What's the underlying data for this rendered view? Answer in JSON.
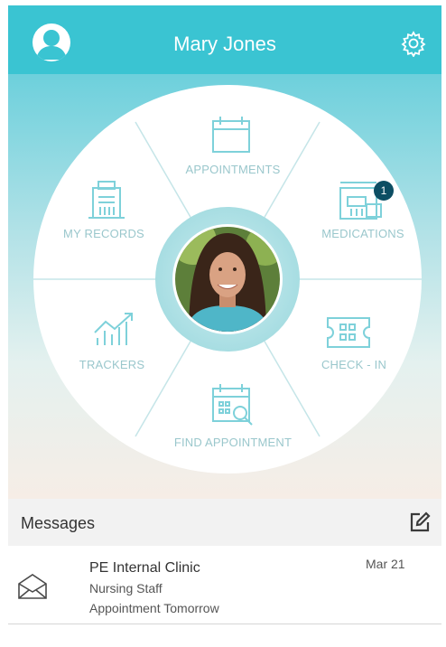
{
  "header": {
    "title": "Mary Jones",
    "accent_color": "#3ac4d2",
    "avatar_icon": "user-avatar-icon",
    "settings_icon": "gear-icon"
  },
  "dashboard": {
    "segments": [
      {
        "label": "APPOINTMENTS",
        "icon": "calendar-icon"
      },
      {
        "label": "MEDICATIONS",
        "icon": "medications-icon",
        "badge": "1"
      },
      {
        "label": "CHECK - IN",
        "icon": "ticket-icon"
      },
      {
        "label": "FIND APPOINTMENT",
        "icon": "calendar-search-icon"
      },
      {
        "label": "TRACKERS",
        "icon": "chart-icon"
      },
      {
        "label": "MY RECORDS",
        "icon": "building-icon"
      }
    ],
    "center_icon": "profile-photo"
  },
  "messages": {
    "title": "Messages",
    "compose_icon": "compose-icon",
    "items": [
      {
        "from": "PE Internal Clinic",
        "subtitle": "Nursing Staff",
        "preview": "Appointment Tomorrow",
        "date": "Mar 21",
        "icon": "envelope-icon"
      }
    ]
  }
}
